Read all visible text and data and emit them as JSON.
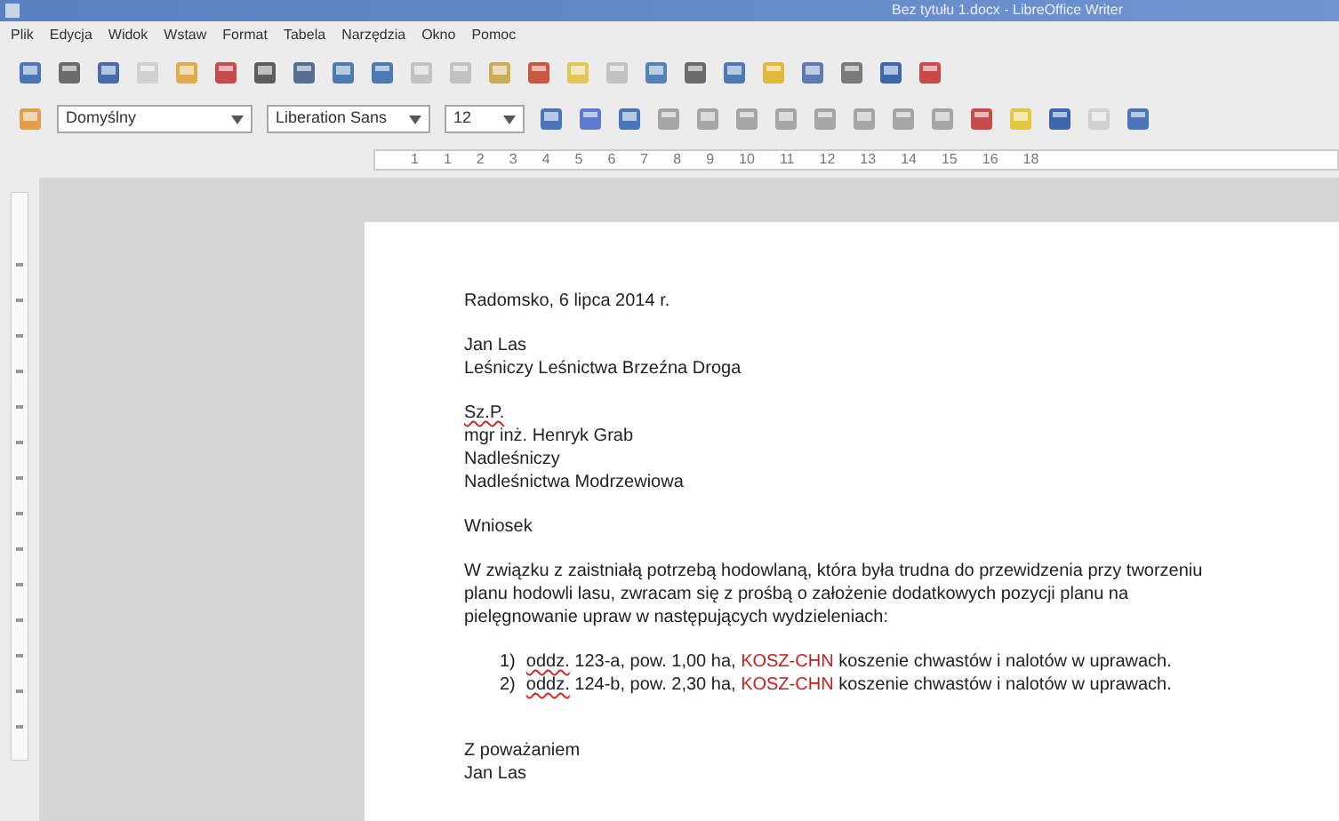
{
  "window": {
    "title": "Bez tytułu 1.docx - LibreOffice Writer"
  },
  "menu": [
    "Plik",
    "Edycja",
    "Widok",
    "Wstaw",
    "Format",
    "Tabela",
    "Narzędzia",
    "Okno",
    "Pomoc"
  ],
  "formatting": {
    "style": "Domyślny",
    "font": "Liberation Sans",
    "size": "12"
  },
  "ruler": {
    "ticks": [
      "1",
      "1",
      "2",
      "3",
      "4",
      "5",
      "6",
      "7",
      "8",
      "9",
      "10",
      "11",
      "12",
      "13",
      "14",
      "15",
      "16",
      "18"
    ]
  },
  "document": {
    "blocks": [
      {
        "kind": "lines",
        "lines": [
          {
            "text": "Radomsko, 6 lipca 2014 r.",
            "misspelled": false
          }
        ]
      },
      {
        "kind": "lines",
        "lines": [
          {
            "text": "Jan Las",
            "misspelled": false
          },
          {
            "text": "Leśniczy Leśnictwa Brzeźna Droga",
            "misspelled": false
          }
        ]
      },
      {
        "kind": "lines",
        "lines": [
          {
            "text": "Sz.P.",
            "misspelled": true
          },
          {
            "text": "mgr inż. Henryk Grab",
            "misspelled": false
          },
          {
            "text": "Nadleśniczy",
            "misspelled": false
          },
          {
            "text": "Nadleśnictwa Modrzewiowa",
            "misspelled": false
          }
        ]
      },
      {
        "kind": "lines",
        "lines": [
          {
            "text": "Wniosek",
            "misspelled": false
          }
        ]
      },
      {
        "kind": "paragraph",
        "text": "W związku z zaistniałą potrzebą hodowlaną, która była trudna do przewidzenia przy tworzeniu planu hodowli lasu, zwracam się z prośbą o założenie dodatkowych pozycji planu na pielęgnowanie upraw w następujących wydzieleniach:"
      },
      {
        "kind": "list",
        "items": [
          {
            "number": "1)",
            "parts": [
              {
                "text": "oddz.",
                "kind": "misspelled"
              },
              {
                "text": " 123-a, pow. 1,00 ha, ",
                "kind": "plain"
              },
              {
                "text": "KOSZ-CHN",
                "kind": "code"
              },
              {
                "text": " koszenie chwastów i nalotów w uprawach.",
                "kind": "plain"
              }
            ]
          },
          {
            "number": "2)",
            "parts": [
              {
                "text": "oddz.",
                "kind": "misspelled"
              },
              {
                "text": " 124-b, pow. 2,30 ha, ",
                "kind": "plain"
              },
              {
                "text": "KOSZ-CHN",
                "kind": "code"
              },
              {
                "text": " koszenie chwastów i nalotów w uprawach.",
                "kind": "plain"
              }
            ]
          }
        ]
      },
      {
        "kind": "lines",
        "lines": [
          {
            "text": "Z poważaniem",
            "misspelled": false
          },
          {
            "text": "Jan Las",
            "misspelled": false
          }
        ]
      }
    ]
  }
}
